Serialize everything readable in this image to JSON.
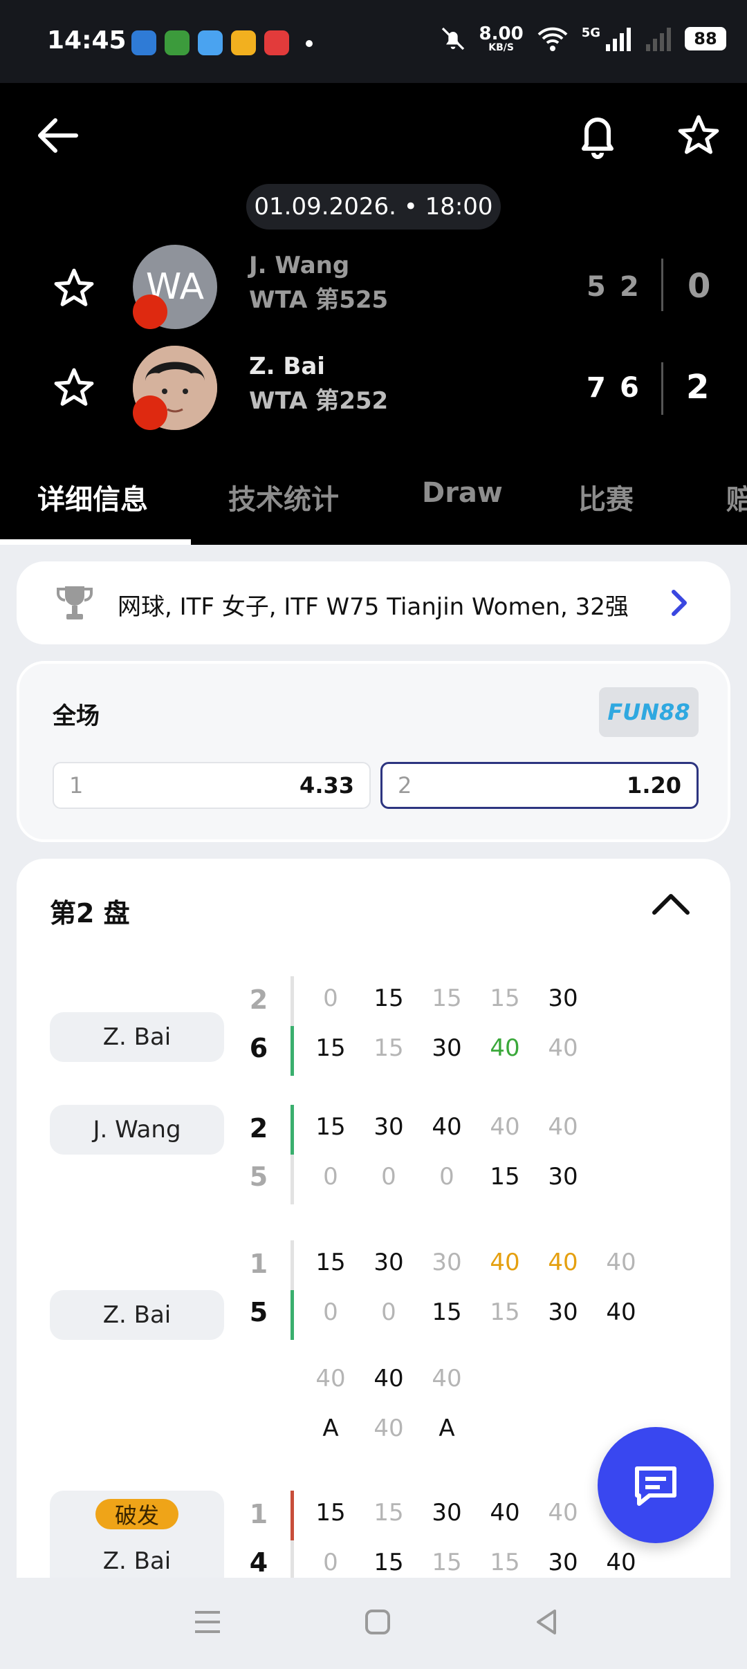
{
  "status_bar": {
    "time": "14:45",
    "net_speed": "8.00",
    "net_unit": "KB/S",
    "net_type": "5G",
    "battery": "88"
  },
  "header": {
    "datetime": "01.09.2026. • 18:00",
    "players": [
      {
        "name": "J. Wang",
        "rank": "WTA 第525",
        "initials": "WA",
        "sets": [
          "5",
          "2"
        ],
        "total": "0"
      },
      {
        "name": "Z. Bai",
        "rank": "WTA 第252",
        "sets": [
          "7",
          "6"
        ],
        "total": "2"
      }
    ]
  },
  "tabs": [
    "详细信息",
    "技术统计",
    "Draw",
    "比赛",
    "赔"
  ],
  "tournament": {
    "text": "网球, ITF 女子, ITF W75 Tianjin Women, 32强"
  },
  "odds": {
    "title": "全场",
    "bookmaker": "FUN88",
    "options": [
      {
        "label": "1",
        "value": "4.33"
      },
      {
        "label": "2",
        "value": "1.20"
      }
    ]
  },
  "set_section": {
    "title": "第2 盘",
    "blocks": [
      {
        "server": "Z. Bai",
        "games_top": "2",
        "games_bottom": "6",
        "top_points": [
          "0",
          "15",
          "15",
          "15",
          "30"
        ],
        "bottom_points": [
          "15",
          "15",
          "30",
          "40",
          "40"
        ]
      },
      {
        "server": "J. Wang",
        "games_top": "2",
        "games_bottom": "5",
        "top_points": [
          "15",
          "30",
          "40",
          "40",
          "40"
        ],
        "bottom_points": [
          "0",
          "0",
          "0",
          "15",
          "30"
        ]
      },
      {
        "server": "Z. Bai",
        "games_top": "1",
        "games_bottom": "5",
        "top_points": [
          "15",
          "30",
          "30",
          "40",
          "40",
          "40"
        ],
        "bottom_points": [
          "0",
          "0",
          "15",
          "15",
          "30",
          "40"
        ],
        "extra_top": [
          "40",
          "40",
          "40"
        ],
        "extra_bottom": [
          "A",
          "40",
          "A"
        ]
      },
      {
        "badge": "破发",
        "server": "Z. Bai",
        "games_top": "1",
        "games_bottom": "4",
        "top_points": [
          "15",
          "15",
          "30",
          "40",
          "40"
        ],
        "bottom_points": [
          "0",
          "15",
          "15",
          "15",
          "30",
          "40"
        ]
      }
    ]
  }
}
